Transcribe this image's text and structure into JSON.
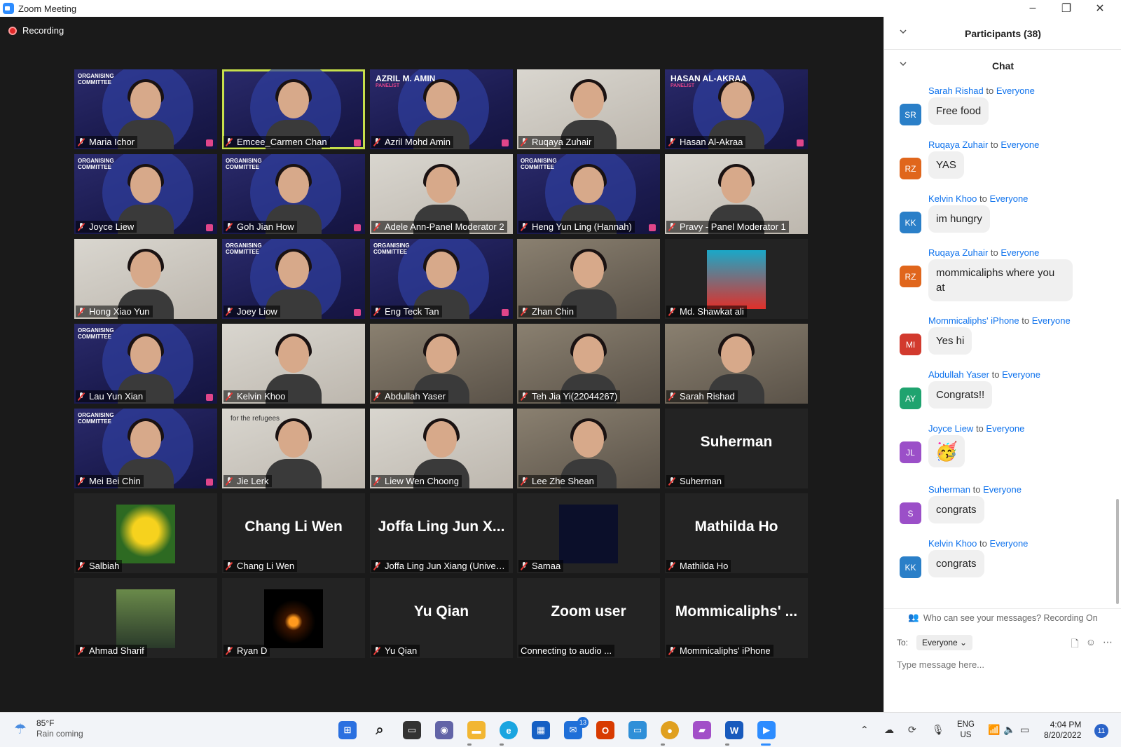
{
  "window": {
    "title": "Zoom Meeting",
    "controls": [
      "–",
      "❐",
      "✕"
    ]
  },
  "recording": {
    "label": "Recording"
  },
  "tiles": [
    {
      "name": "Maria Ichor",
      "kind": "video",
      "org": "ORGANISING\nCOMMITTEE"
    },
    {
      "name": "Emcee_Carmen Chan",
      "kind": "video",
      "active": true
    },
    {
      "name": "Azril Mohd Amin",
      "kind": "video",
      "panel": "AZRIL M. AMIN",
      "panel_sub": "PANELIST"
    },
    {
      "name": "Ruqaya Zuhair",
      "kind": "photo"
    },
    {
      "name": "Hasan Al-Akraa",
      "kind": "video",
      "panel": "HASAN AL-AKRAA",
      "panel_sub": "PANELIST"
    },
    {
      "name": "Joyce Liew",
      "kind": "video",
      "org": "ORGANISING\nCOMMITTEE"
    },
    {
      "name": "Goh Jian How",
      "kind": "video",
      "org": "ORGANISING\nCOMMITTEE"
    },
    {
      "name": "Adele Ann-Panel Moderator 2",
      "kind": "photo"
    },
    {
      "name": "Heng Yun Ling (Hannah)",
      "kind": "video",
      "org": "ORGANISING\nCOMMITTEE"
    },
    {
      "name": "Pravy - Panel Moderator 1",
      "kind": "photo"
    },
    {
      "name": "Hong Xiao Yun",
      "kind": "photo"
    },
    {
      "name": "Joey Liow",
      "kind": "video",
      "org": "ORGANISING\nCOMMITTEE"
    },
    {
      "name": "Eng Teck Tan",
      "kind": "video",
      "org": "ORGANISING\nCOMMITTEE"
    },
    {
      "name": "Zhan Chin",
      "kind": "photo2"
    },
    {
      "name": "Md. Shawkat ali",
      "kind": "dark-photo"
    },
    {
      "name": "Lau Yun Xian",
      "kind": "video",
      "org": "ORGANISING\nCOMMITTEE"
    },
    {
      "name": "Kelvin Khoo",
      "kind": "photo"
    },
    {
      "name": "Abdullah Yaser",
      "kind": "photo2"
    },
    {
      "name": "Teh Jia Yi(22044267)",
      "kind": "photo2"
    },
    {
      "name": "Sarah Rishad",
      "kind": "photo2"
    },
    {
      "name": "Mei Bei Chin",
      "kind": "video",
      "org": "ORGANISING\nCOMMITTEE"
    },
    {
      "name": "Jie Lerk",
      "kind": "photo",
      "overlay": "for the refugees"
    },
    {
      "name": "Liew Wen Choong",
      "kind": "photo"
    },
    {
      "name": "Lee Zhe Shean",
      "kind": "photo2"
    },
    {
      "name": "Suherman",
      "kind": "name",
      "big": "Suherman"
    },
    {
      "name": "Salbiah",
      "kind": "avatar",
      "avatar": "flower"
    },
    {
      "name": "Chang Li Wen",
      "kind": "name",
      "big": "Chang Li Wen"
    },
    {
      "name": "Joffa Ling Jun Xiang (Univer...",
      "kind": "name",
      "big": "Joffa Ling Jun X..."
    },
    {
      "name": "Samaa",
      "kind": "avatar",
      "avatar": "stars"
    },
    {
      "name": "Mathilda Ho",
      "kind": "name",
      "big": "Mathilda Ho"
    },
    {
      "name": "Ahmad Sharif",
      "kind": "avatar",
      "avatar": "person"
    },
    {
      "name": "Ryan D",
      "kind": "avatar",
      "avatar": "candle"
    },
    {
      "name": "Yu Qian",
      "kind": "name",
      "big": "Yu Qian"
    },
    {
      "name": "Connecting to audio ...",
      "kind": "name",
      "big": "Zoom user",
      "nomic": true
    },
    {
      "name": "Mommicaliphs' iPhone",
      "kind": "name",
      "big": "Mommicaliphs' ..."
    }
  ],
  "side": {
    "participants_title": "Participants (38)",
    "chat_title": "Chat",
    "to_word": "to",
    "messages": [
      {
        "from": "Sarah Rishad",
        "to": "Everyone",
        "initials": "SR",
        "color": "#2a7fc8",
        "text": "Free food"
      },
      {
        "from": "Ruqaya Zuhair",
        "to": "Everyone",
        "initials": "RZ",
        "color": "#e0661c",
        "text": "YAS"
      },
      {
        "from": "Kelvin Khoo",
        "to": "Everyone",
        "initials": "KK",
        "color": "#2a7fc8",
        "text": "im hungry"
      },
      {
        "from": "Ruqaya Zuhair",
        "to": "Everyone",
        "initials": "RZ",
        "color": "#e0661c",
        "text": "mommicaliphs where you at"
      },
      {
        "from": "Mommicaliphs' iPhone",
        "to": "Everyone",
        "initials": "MI",
        "color": "#d23a2e",
        "text": "Yes hi"
      },
      {
        "from": "Abdullah Yaser",
        "to": "Everyone",
        "initials": "AY",
        "color": "#1fa36f",
        "text": "Congrats!!"
      },
      {
        "from": "Joyce Liew",
        "to": "Everyone",
        "initials": "JL",
        "color": "#9b4fc8",
        "text": "🥳"
      },
      {
        "from": "Suherman",
        "to": "Everyone",
        "initials": "S",
        "color": "#9b4fc8",
        "text": "congrats"
      },
      {
        "from": "Kelvin Khoo",
        "to": "Everyone",
        "initials": "KK",
        "color": "#2a7fc8",
        "text": "congrats"
      }
    ],
    "who_can_see": "Who can see your messages? Recording On",
    "to_label": "To:",
    "to_value": "Everyone",
    "input_placeholder": "Type message here..."
  },
  "taskbar": {
    "weather_temp": "85°F",
    "weather_text": "Rain coming",
    "mail_badge": "13",
    "lang_1": "ENG",
    "lang_2": "US",
    "time": "4:04 PM",
    "date": "8/20/2022",
    "notifications": "11"
  }
}
